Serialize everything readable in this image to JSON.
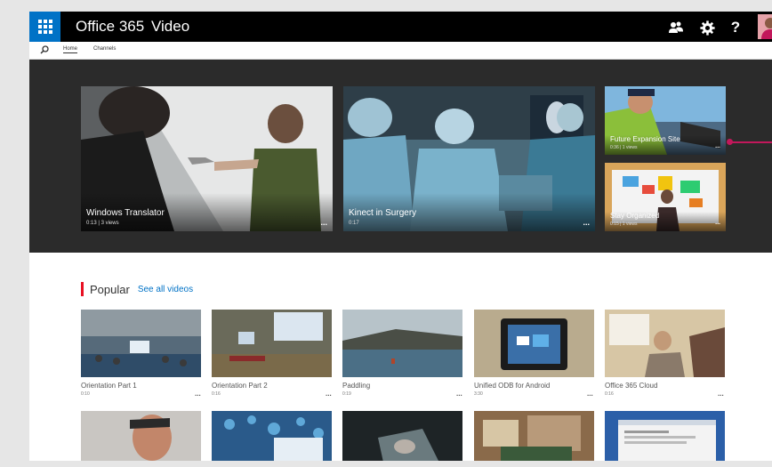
{
  "header": {
    "app_name": "Office 365",
    "section": "Video",
    "icons": [
      "people-icon",
      "gear-icon",
      "help-icon"
    ],
    "help_label": "?"
  },
  "subnav": {
    "tabs": [
      {
        "label": "Home"
      },
      {
        "label": "Channels"
      }
    ]
  },
  "hero": {
    "tiles": [
      {
        "title": "Windows Translator",
        "meta": "0:13 | 3 views",
        "more": "..."
      },
      {
        "title": "Kinect in Surgery",
        "meta": "0:17",
        "more": "..."
      },
      {
        "title": "Future Expansion Site",
        "meta": "0:36 | 1 views",
        "more": "..."
      },
      {
        "title": "Stay Organized",
        "meta": "0:15 | 1 views",
        "more": "..."
      }
    ]
  },
  "popular": {
    "heading": "Popular",
    "see_all": "See all videos",
    "videos": [
      {
        "title": "Orientation Part 1",
        "duration": "0:10",
        "more": "..."
      },
      {
        "title": "Orientation Part 2",
        "duration": "0:16",
        "more": "..."
      },
      {
        "title": "Paddling",
        "duration": "0:19",
        "more": "..."
      },
      {
        "title": "Unified ODB for Android",
        "duration": "3:30",
        "more": "..."
      },
      {
        "title": "Office 365 Cloud",
        "duration": "0:16",
        "more": "..."
      }
    ]
  },
  "colors": {
    "accent": "#0072c6",
    "popular_bar": "#e81123",
    "hero_bg": "#2b2b2b"
  }
}
